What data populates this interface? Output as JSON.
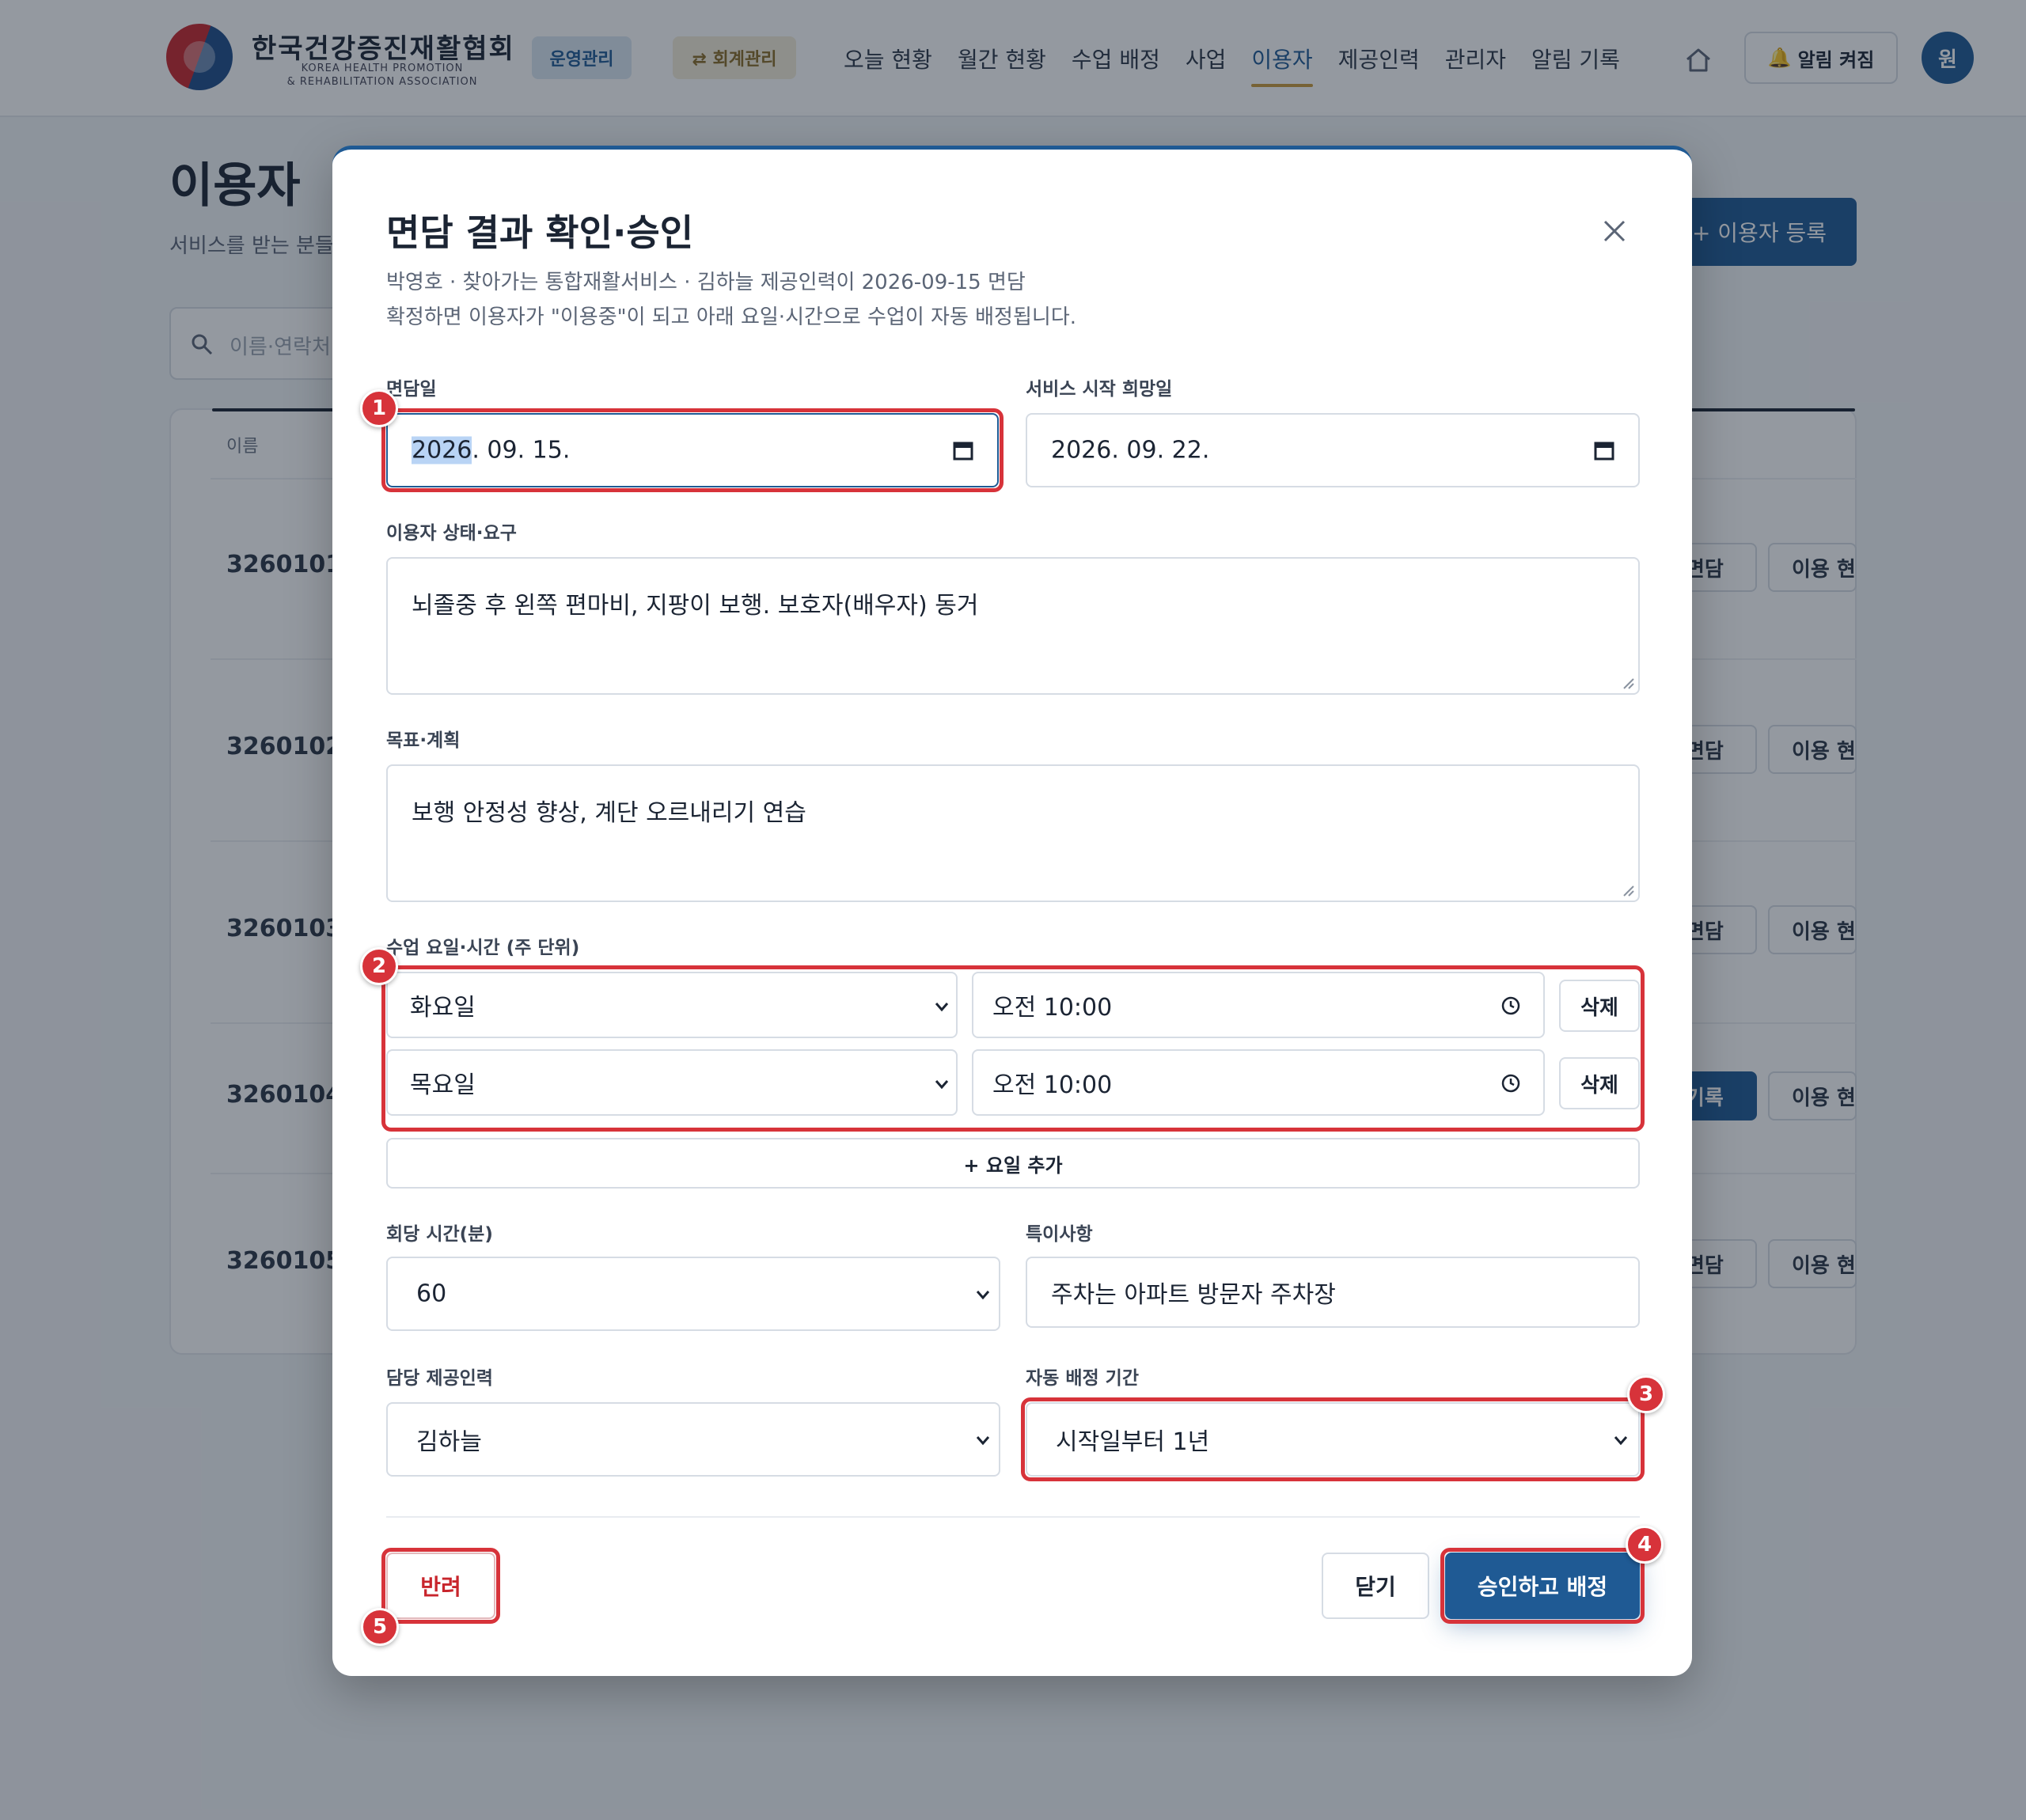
{
  "header": {
    "org_name": "한국건강증진재활협회",
    "org_en_line1": "KOREA HEALTH PROMOTION",
    "org_en_line2": "& REHABILITATION ASSOCIATION",
    "badge_operation": "운영관리",
    "badge_accounting": "⇄ 회계관리",
    "nav": [
      {
        "label": "오늘 현황",
        "active": false
      },
      {
        "label": "월간 현황",
        "active": false
      },
      {
        "label": "수업 배정",
        "active": false
      },
      {
        "label": "사업",
        "active": false
      },
      {
        "label": "이용자",
        "active": true
      },
      {
        "label": "제공인력",
        "active": false
      },
      {
        "label": "관리자",
        "active": false
      },
      {
        "label": "알림 기록",
        "active": false
      }
    ],
    "alert_button": "알림 켜짐",
    "avatar_initial": "원"
  },
  "page": {
    "title": "이용자",
    "subtitle": "서비스를 받는 분들",
    "register_button": "+ 이용자 등록",
    "search_placeholder": "이름·연락처",
    "table_header_name": "이름",
    "rows": [
      {
        "id": "3260101",
        "action": "면담",
        "status": "이용 현황"
      },
      {
        "id": "3260102",
        "action": "면담",
        "status": "이용 현황"
      },
      {
        "id": "3260103",
        "action": "면담",
        "status": "이용 현황"
      },
      {
        "id": "3260104",
        "action": "기록",
        "status": "이용 현황"
      },
      {
        "id": "3260105",
        "action": "면담",
        "status": "이용 현황"
      }
    ]
  },
  "modal": {
    "title": "면담 결과 확인·승인",
    "description_line1": "박영호 · 찾아가는 통합재활서비스 · 김하늘 제공인력이 2026-09-15 면담",
    "description_line2": "확정하면 이용자가 \"이용중\"이 되고 아래 요일·시간으로 수업이 자동 배정됩니다.",
    "interview_date_label": "면담일",
    "interview_date_year": "2026",
    "interview_date_rest": ". 09. 15.",
    "start_date_label": "서비스 시작 희망일",
    "start_date_value": "2026. 09. 22.",
    "status_label": "이용자 상태·요구",
    "status_value": "뇌졸중 후 왼쪽 편마비, 지팡이 보행. 보호자(배우자) 동거",
    "goal_label": "목표·계획",
    "goal_value": "보행 안정성 향상, 계단 오르내리기 연습",
    "schedule_label": "수업 요일·시간 (주 단위)",
    "schedule": [
      {
        "day": "화요일",
        "time": "오전 10:00",
        "delete": "삭제"
      },
      {
        "day": "목요일",
        "time": "오전 10:00",
        "delete": "삭제"
      }
    ],
    "add_day_button": "+ 요일 추가",
    "duration_label": "회당 시간(분)",
    "duration_value": "60",
    "notes_label": "특이사항",
    "notes_value": "주차는 아파트 방문자 주차장",
    "provider_label": "담당 제공인력",
    "provider_value": "김하늘",
    "period_label": "자동 배정 기간",
    "period_value": "시작일부터 1년",
    "reject_button": "반려",
    "close_button": "닫기",
    "approve_button": "승인하고 배정"
  },
  "callouts": [
    "1",
    "2",
    "3",
    "4",
    "5"
  ],
  "colors": {
    "primary": "#1f5a94",
    "accent_gold": "#c99a3a",
    "callout_red": "#d7333a",
    "reject_red": "#c8252c"
  },
  "icons": [
    "home-icon",
    "bell-icon",
    "search-icon",
    "close-icon",
    "calendar-icon",
    "clock-icon",
    "chevron-down-icon"
  ]
}
